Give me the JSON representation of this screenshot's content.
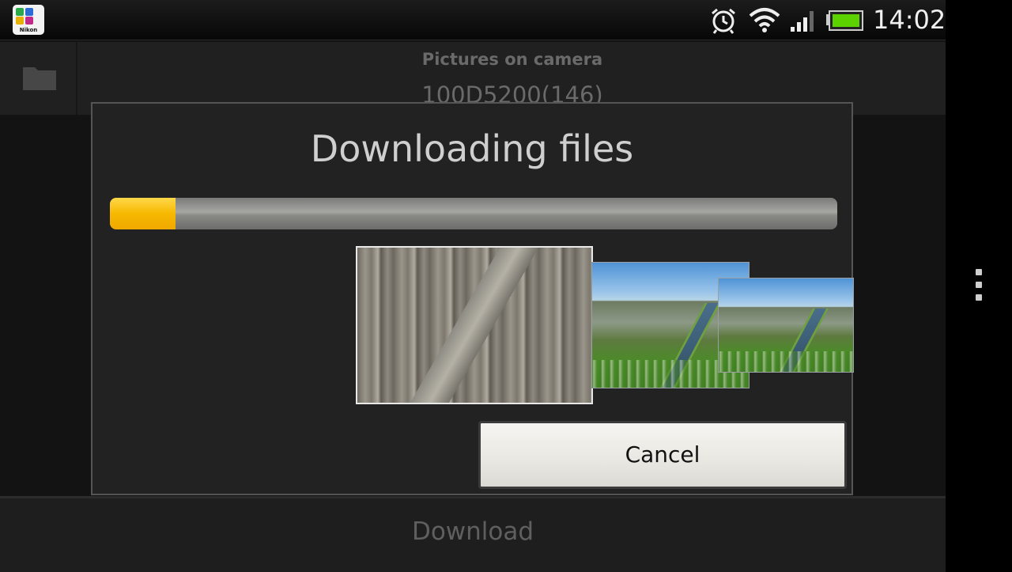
{
  "status_bar": {
    "app_icon": "nikon-wireless-mobile-utility-icon",
    "app_icon_brand": "Nikon",
    "icons": [
      "alarm-icon",
      "wifi-icon",
      "signal-icon",
      "battery-icon"
    ],
    "time": "14:02"
  },
  "app": {
    "header": {
      "folder_icon": "folder-icon",
      "title": "Pictures on camera",
      "subtitle": "100D5200(146)"
    },
    "footer": {
      "download_label": "Download"
    }
  },
  "dialog": {
    "title": "Downloading files",
    "progress_fraction": 0.09,
    "thumbnails": [
      "wood-fence-photo",
      "field-ditch-photo",
      "field-ditch-photo"
    ],
    "cancel_label": "Cancel"
  },
  "side": {
    "overflow_icon": "overflow-menu-icon"
  },
  "colors": {
    "progress_fill": "#f7b800",
    "battery_green": "#5cd300"
  }
}
